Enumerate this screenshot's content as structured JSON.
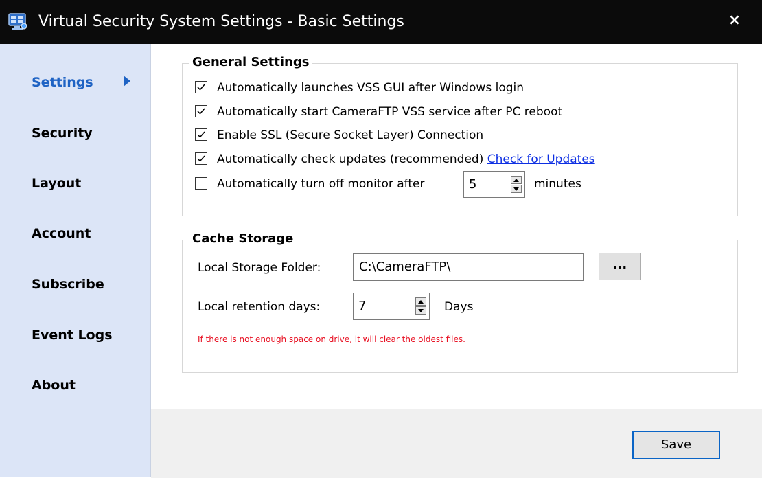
{
  "window": {
    "title": "Virtual Security System Settings - Basic Settings",
    "app_icon": "vss-app-icon",
    "close_label": "×",
    "accent_color": "#1f63c4",
    "warning_color": "#e81123"
  },
  "sidebar": {
    "items": [
      {
        "label": "Settings",
        "active": true
      },
      {
        "label": "Security",
        "active": false
      },
      {
        "label": "Layout",
        "active": false
      },
      {
        "label": "Account",
        "active": false
      },
      {
        "label": "Subscribe",
        "active": false
      },
      {
        "label": "Event Logs",
        "active": false
      },
      {
        "label": "About",
        "active": false
      }
    ],
    "active_indicator": "chevron-right-icon"
  },
  "general": {
    "title": "General Settings",
    "options": [
      {
        "label": "Automatically launches VSS GUI after Windows login",
        "checked": true
      },
      {
        "label": "Automatically start CameraFTP VSS service after PC reboot",
        "checked": true
      },
      {
        "label": "Enable SSL (Secure Socket Layer) Connection",
        "checked": true
      },
      {
        "label": "Automatically check updates (recommended)",
        "checked": true
      },
      {
        "label": "Automatically turn off monitor after",
        "checked": false
      }
    ],
    "update_link": "Check for Updates",
    "monitor_minutes": "5",
    "minutes_unit": "minutes"
  },
  "cache": {
    "title": "Cache Storage",
    "folder_label": "Local Storage Folder:",
    "folder_value": "C:\\CameraFTP\\",
    "browse_label": "...",
    "retention_label": "Local retention days:",
    "retention_value": "7",
    "days_unit": "Days",
    "warning": "If there is not enough space on drive, it will clear the oldest files."
  },
  "footer": {
    "save_label": "Save"
  }
}
